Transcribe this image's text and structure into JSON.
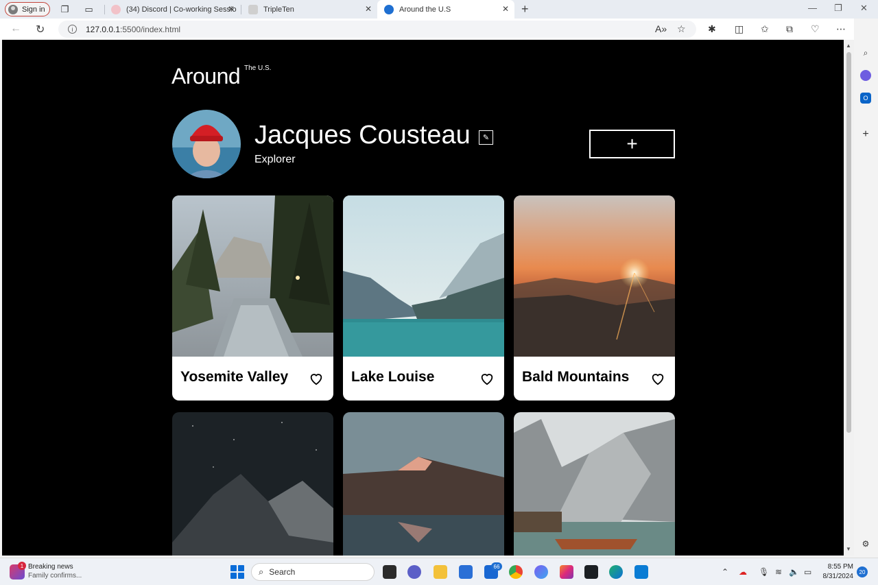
{
  "browser": {
    "signin_label": "Sign in",
    "tabs": [
      {
        "title": "(34) Discord | Co-working Sessio",
        "active": false
      },
      {
        "title": "TripleTen",
        "active": false
      },
      {
        "title": "Around the U.S",
        "active": true
      }
    ],
    "url_host": "127.0.0.1",
    "url_rest": ":5500/index.html"
  },
  "page": {
    "logo": "Around",
    "logo_sup": "The U.S.",
    "profile": {
      "name": "Jacques Cousteau",
      "job": "Explorer"
    },
    "add_button_label": "+",
    "cards": [
      {
        "title": "Yosemite Valley"
      },
      {
        "title": "Lake Louise"
      },
      {
        "title": "Bald Mountains"
      },
      {
        "title": ""
      },
      {
        "title": ""
      },
      {
        "title": ""
      }
    ]
  },
  "taskbar": {
    "news_title": "Breaking news",
    "news_sub": "Family confirms...",
    "news_badge": "1",
    "search_label": "Search",
    "mail_badge": "66",
    "time": "8:55 PM",
    "date": "8/31/2024",
    "notifications": "20"
  },
  "colors": {
    "page_bg": "#000000",
    "card_bg": "#ffffff",
    "text_on_dark": "#ffffff",
    "accent_blue": "#1f6fd1"
  }
}
